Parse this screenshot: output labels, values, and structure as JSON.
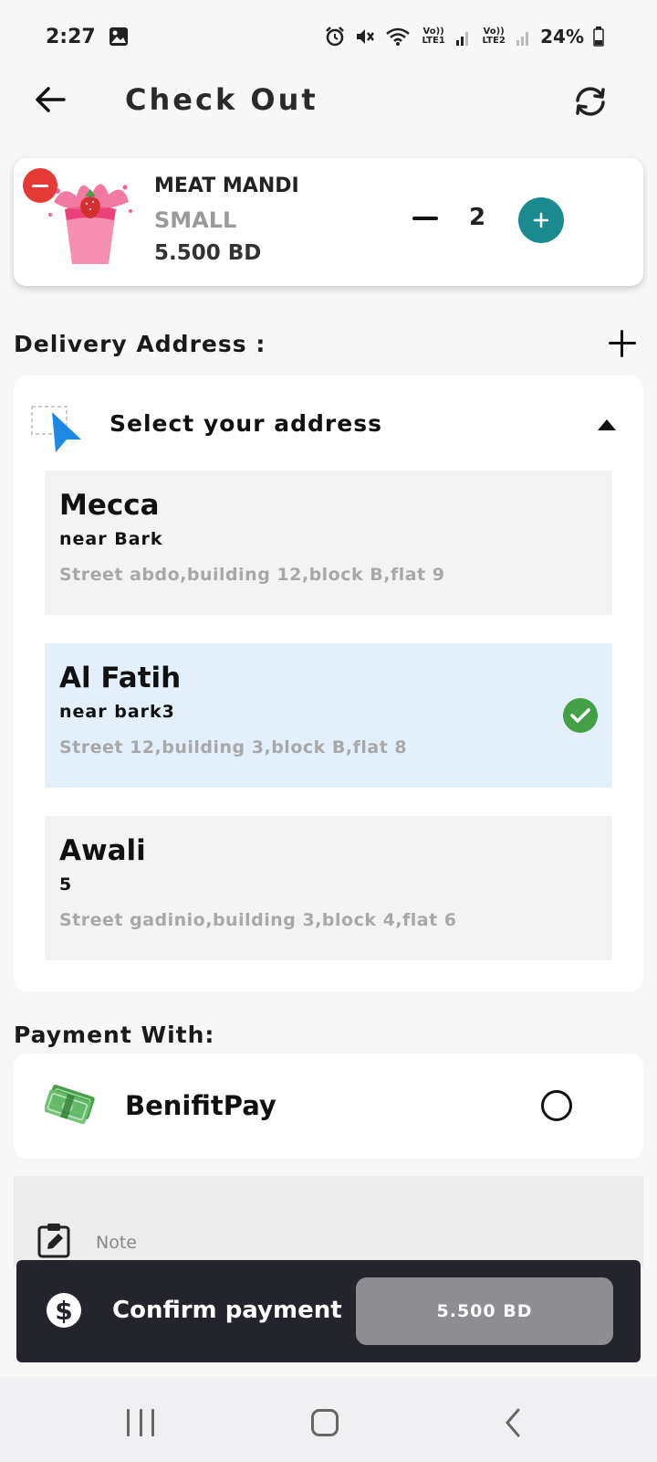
{
  "status_bar": {
    "time": "2:27",
    "wifi_label_1": "Vo)) LTE1",
    "lte2_label": "Vo)) LTE2",
    "battery": "24%"
  },
  "app_bar": {
    "title": "Check Out",
    "back_icon": "arrow-left-icon",
    "refresh_icon": "refresh-icon"
  },
  "cart": {
    "items": [
      {
        "name": "MEAT MANDI",
        "size": "SMALL",
        "price": "5.500 BD",
        "quantity": "2"
      }
    ]
  },
  "delivery": {
    "title": "Delivery Address :",
    "select_label": "Select your address",
    "addresses": [
      {
        "city": "Mecca",
        "near": "near Bark",
        "street": "Street abdo,building 12,block B,flat 9",
        "selected": false
      },
      {
        "city": "Al Fatih",
        "near": "near bark3",
        "street": "Street 12,building 3,block B,flat 8",
        "selected": true
      },
      {
        "city": "Awali",
        "near": "5",
        "street": "Street gadinio,building 3,block 4,flat 6",
        "selected": false
      }
    ]
  },
  "payment": {
    "title": "Payment With:",
    "method": "BenifitPay",
    "selected": false
  },
  "note": {
    "placeholder": "Note"
  },
  "confirm": {
    "label": "Confirm payment",
    "total": "5.500 BD"
  },
  "colors": {
    "accent": "#1b8a8f",
    "remove": "#e53935",
    "selected_bg": "#e3f0fb",
    "check": "#43a047",
    "confirm_bar": "#24242c"
  }
}
